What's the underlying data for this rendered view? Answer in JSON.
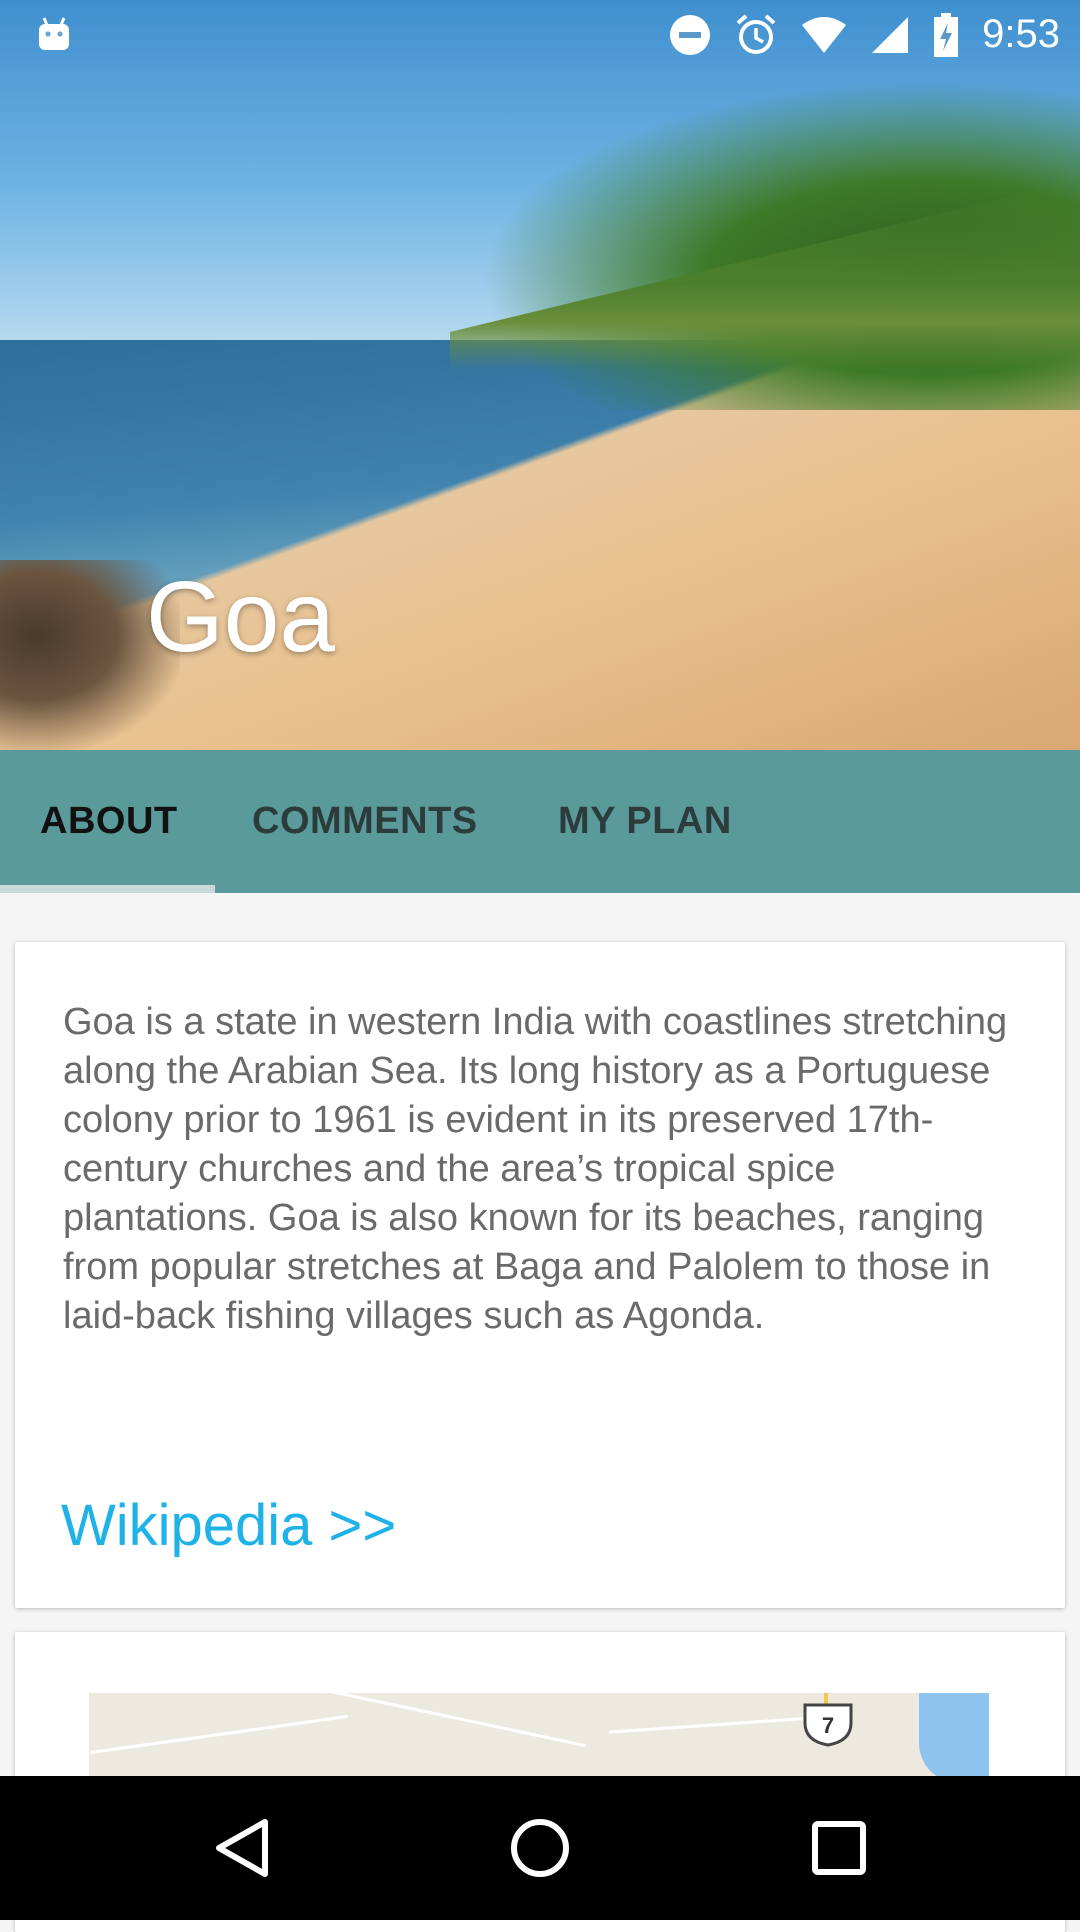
{
  "status_bar": {
    "time": "9:53",
    "icons": [
      "android-icon",
      "do-not-disturb-icon",
      "alarm-icon",
      "wifi-icon",
      "signal-icon",
      "battery-charging-icon"
    ]
  },
  "hero": {
    "title": "Goa"
  },
  "tabs": [
    {
      "label": "ABOUT",
      "active": true
    },
    {
      "label": "COMMENTS",
      "active": false
    },
    {
      "label": "MY PLAN",
      "active": false
    }
  ],
  "about": {
    "description": "Goa is a state in western India with coastlines stretching along the Arabian Sea. Its long history as a Portuguese colony prior to 1961 is evident in its preserved 17th-century churches and the area’s tropical spice plantations. Goa is also known for its beaches, ranging from popular stretches at Baga and Palolem to those in laid-back fishing villages such as Agonda.",
    "link_label": "Wikipedia >>"
  },
  "map": {
    "route_shield_label": "7"
  },
  "colors": {
    "tab_bar": "#5a9a9a",
    "link": "#1eb2e8",
    "body_text": "#6a6a6a"
  },
  "nav_bar": {
    "buttons": [
      "back-icon",
      "home-icon",
      "recents-icon"
    ]
  }
}
